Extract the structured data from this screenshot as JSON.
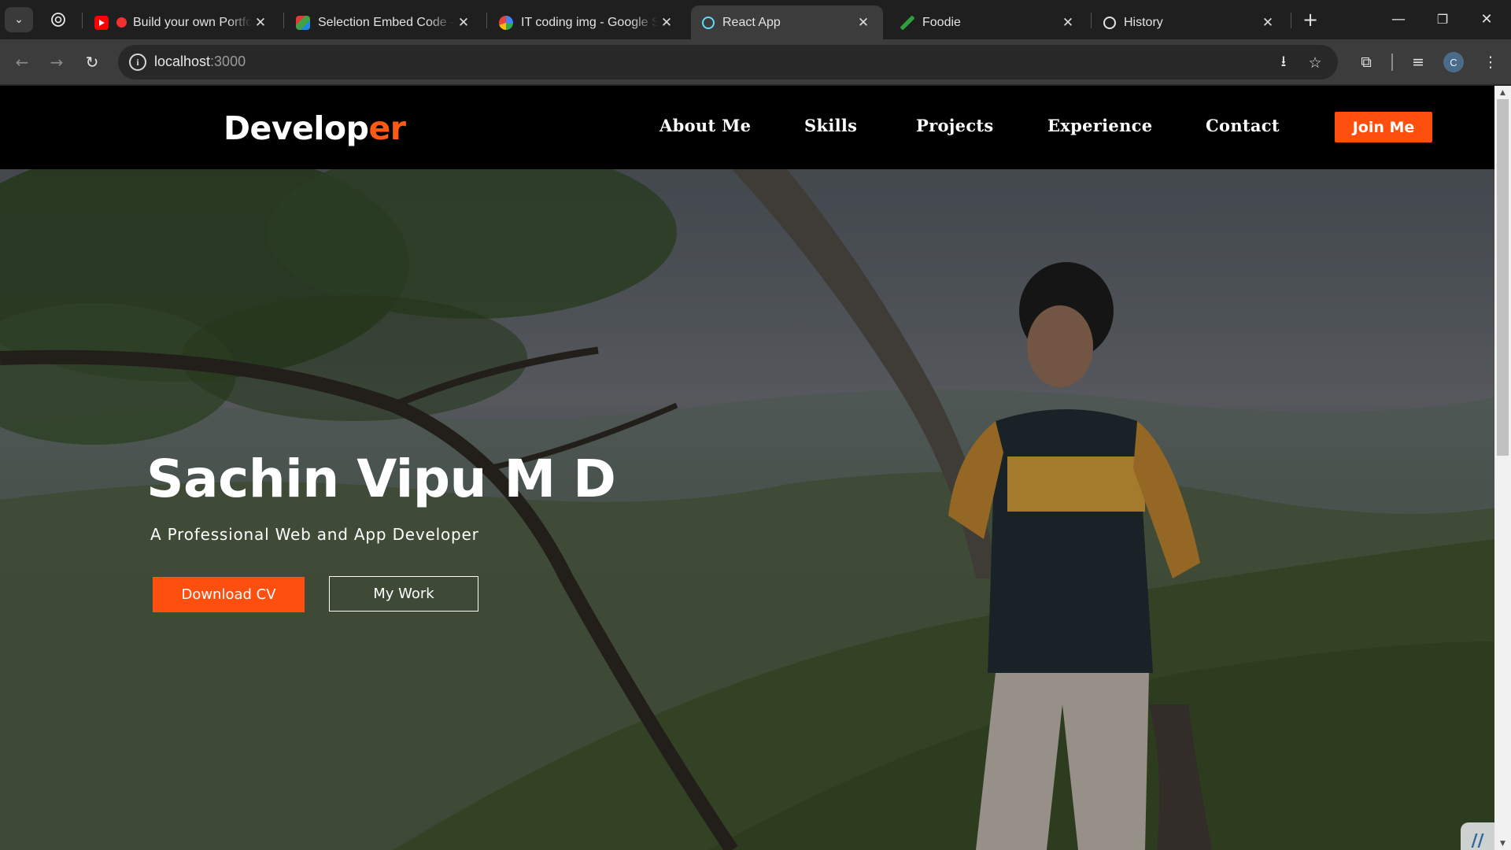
{
  "browser": {
    "tabs": [
      {
        "title": "Build your own Portfo",
        "icon": "youtube-icon"
      },
      {
        "title": "Selection Embed Code - (",
        "icon": "zoho-icon"
      },
      {
        "title": "IT coding img - Google S",
        "icon": "google-icon"
      },
      {
        "title": "React App",
        "icon": "react-icon",
        "active": true
      },
      {
        "title": "Foodie",
        "icon": "leaf-icon"
      },
      {
        "title": "History",
        "icon": "history-icon"
      }
    ],
    "address": {
      "host": "localhost",
      "port": ":3000"
    },
    "profile_initial": "C"
  },
  "site": {
    "logo": {
      "main": "Develop",
      "accent": "er"
    },
    "nav": [
      "About Me",
      "Skills",
      "Projects",
      "Experience",
      "Contact"
    ],
    "cta_label": "Join Me",
    "accent_color": "#ff4f0f"
  },
  "hero": {
    "name": "Sachin Vipu M D",
    "subtitle": "A Professional Web and App Developer",
    "primary_button": "Download CV",
    "secondary_button": "My Work"
  }
}
